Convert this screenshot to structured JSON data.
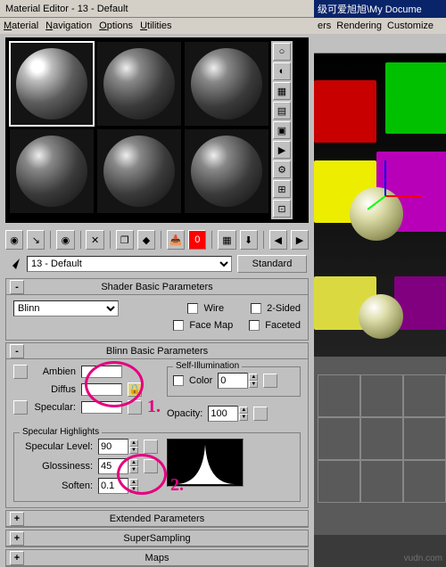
{
  "title": "Material Editor - 13 - Default",
  "menu": {
    "material": "Material",
    "navigation": "Navigation",
    "options": "Options",
    "utilities": "Utilities"
  },
  "right": {
    "title": "级可爱旭旭\\My Docume",
    "menu": {
      "ers": "ers",
      "rendering": "Rendering",
      "customize": "Customize"
    }
  },
  "name_row": {
    "name": "13 - Default",
    "type_button": "Standard"
  },
  "rollups": {
    "shader": {
      "title": "Shader Basic Parameters",
      "toggle": "-",
      "shader_select": "Blinn",
      "wire": "Wire",
      "two_sided": "2-Sided",
      "face_map": "Face Map",
      "faceted": "Faceted"
    },
    "blinn": {
      "title": "Blinn Basic Parameters",
      "toggle": "-",
      "ambient": "Ambien",
      "diffuse": "Diffus",
      "specular": "Specular:",
      "self_illum": "Self-Illumination",
      "color": "Color",
      "color_val": "0",
      "opacity": "Opacity:",
      "opacity_val": "100",
      "spec_group": "Specular Highlights",
      "spec_level": "Specular Level:",
      "spec_level_val": "90",
      "glossiness": "Glossiness:",
      "glossiness_val": "45",
      "soften": "Soften:",
      "soften_val": "0.1"
    },
    "extended": {
      "title": "Extended Parameters",
      "toggle": "+"
    },
    "supersampling": {
      "title": "SuperSampling",
      "toggle": "+"
    },
    "maps": {
      "title": "Maps",
      "toggle": "+"
    }
  },
  "annotations": {
    "one": "1.",
    "two": "2."
  },
  "watermark": "vudn.com"
}
